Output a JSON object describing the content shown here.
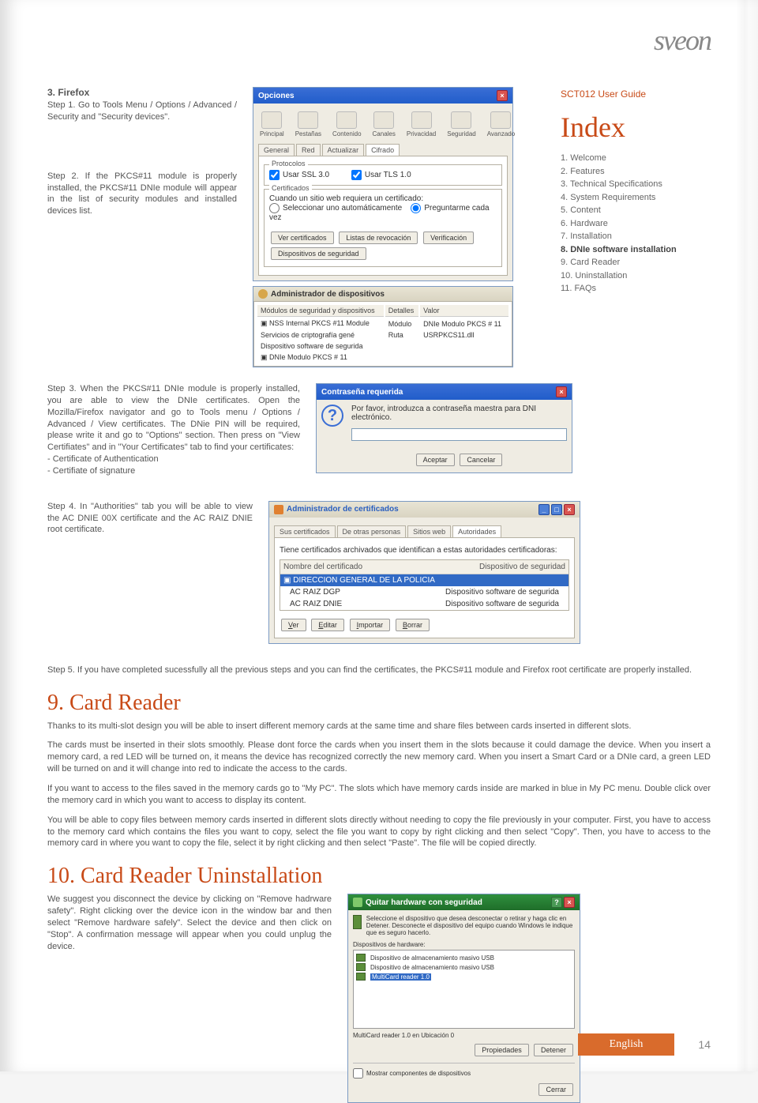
{
  "brand": "sveon",
  "sidebar": {
    "guide_title": "SCT012 User Guide",
    "index_title": "Index",
    "items": [
      "1. Welcome",
      "2. Features",
      "3. Technical Specifications",
      "4. System Requirements",
      "5. Content",
      "6. Hardware",
      "7. Installation",
      "8. DNIe software installation",
      "9. Card Reader",
      "10. Uninstallation",
      "11. FAQs"
    ],
    "bold_index": 7
  },
  "firefox": {
    "heading": "3. Firefox",
    "step1": "Step 1. Go to Tools Menu / Options / Advanced / Security and \"Security devices\".",
    "step2": "Step 2. If the PKCS#11 module is properly installed, the PKCS#11 DNIe module will appear in the list of security modules and installed devices list.",
    "step3": "Step 3. When the PKCS#11 DNIe module is properly installed, you are able to view the DNIe certificates. Open the Mozilla/Firefox navigator and go to Tools menu / Options / Advanced / View certificates. The DNie PIN will be required, please write it and go to \"Options\" section. Then press on \"View Certifiates\" and in \"Your Certificates\" tab to find your certificates:\n- Certificate of Authentication\n- Certifiate of signature",
    "step4": "Step 4. In \"Authorities\" tab you will be able to view the AC DNIE 00X certificate and the AC RAIZ DNIE root certificate.",
    "step5": "Step 5. If you have completed sucessfully all the previous steps and you can find the certificates, the PKCS#11 module and Firefox root certificate are properly installed."
  },
  "opciones": {
    "title": "Opciones",
    "toolbar": [
      "Principal",
      "Pestañas",
      "Contenido",
      "Canales",
      "Privacidad",
      "Seguridad",
      "Avanzado"
    ],
    "tabs": [
      "General",
      "Red",
      "Actualizar",
      "Cifrado"
    ],
    "tab_selected": "Cifrado",
    "group1": "Protocolos",
    "ssl": "Usar SSL 3.0",
    "tls": "Usar TLS 1.0",
    "group2": "Certificados",
    "cert_prompt": "Cuando un sitio web requiera un certificado:",
    "radio1": "Seleccionar uno automáticamente",
    "radio2": "Preguntarme cada vez",
    "btns": [
      "Ver certificados",
      "Listas de revocación",
      "Verificación",
      "Dispositivos de seguridad"
    ]
  },
  "devmgr": {
    "title": "Administrador de dispositivos",
    "cols": [
      "Módulos de seguridad y dispositivos",
      "Detalles",
      "Valor"
    ],
    "rows": [
      [
        "NSS Internal PKCS #11 Module",
        "Módulo",
        "DNIe Modulo PKCS # 11"
      ],
      [
        "Servicios de criptografía gené",
        "Ruta",
        "USRPKCS11.dll"
      ],
      [
        "Dispositivo software de segurida",
        "",
        ""
      ],
      [
        "DNIe Modulo PKCS # 11",
        "",
        ""
      ]
    ]
  },
  "pwd": {
    "title": "Contraseña requerida",
    "msg": "Por favor, introduzca a contraseña maestra para DNI electrónico.",
    "ok": "Aceptar",
    "cancel": "Cancelar"
  },
  "certmgr": {
    "title": "Administrador de certificados",
    "tabs": [
      "Sus certificados",
      "De otras personas",
      "Sitios web",
      "Autoridades"
    ],
    "tab_selected": "Autoridades",
    "desc": "Tiene certificados archivados que identifican a estas autoridades certificadoras:",
    "col1": "Nombre del certificado",
    "col2": "Dispositivo de seguridad",
    "root": "DIRECCION GENERAL DE LA POLICIA",
    "r1n": "AC RAIZ DGP",
    "r1v": "Dispositivo software de segurida",
    "r2n": "AC RAIZ DNIE",
    "r2v": "Dispositivo software de segurida",
    "btns": [
      "Ver",
      "Editar",
      "Importar",
      "Borrar"
    ]
  },
  "section9": {
    "title": "9. Card Reader",
    "p1": "Thanks to its multi-slot design you will be able to insert different memory cards at the same time and share files between cards inserted in different slots.",
    "p2": "The cards must be inserted in their slots smoothly. Please dont force the cards when you insert them in the slots because it could damage the device. When you insert a memory card, a red LED will be turned on, it means the device has recognized correctly the new memory card. When you insert a Smart Card or a DNIe card, a green LED will be turned on and it will change into red to indicate the access to the cards.",
    "p3": "If you want to access to the files saved in the memory cards go to \"My PC\". The slots which have memory cards inside are marked in blue in My PC menu. Double click over the memory card in which you want to access to display its content.",
    "p4": "You will be able to copy files between memory cards inserted in different slots directly without needing to copy the file previously in your computer. First, you have to access to the memory card which contains the files you want to copy, select the file you want to copy by right clicking and then select \"Copy\". Then, you have to access to the memory card in where you want to copy the file, select it by right clicking and then select \"Paste\". The file will be copied directly."
  },
  "section10": {
    "title": "10. Card Reader Uninstallation",
    "p1": "We suggest you disconnect the device by clicking on \"Remove hadrware safety\". Right clicking over the device icon in the window bar and then select \"Remove hardware safely\". Select the device and then click on \"Stop\". A confirmation message will appear when you could unplug the device."
  },
  "safehw": {
    "title": "Quitar hardware con seguridad",
    "desc": "Seleccione el dispositivo que desea desconectar o retirar y haga clic en Detener. Desconecte el dispositivo del equipo cuando Windows le indique que es seguro hacerlo.",
    "group": "Dispositivos de hardware:",
    "d1": "Dispositivo de almacenamiento masivo USB",
    "d2": "Dispositivo de almacenamiento masivo USB",
    "d3": "MultiCard reader 1.0",
    "loc": "MultiCard reader 1.0 en Ubicación 0",
    "btn_props": "Propiedades",
    "btn_stop": "Detener",
    "chk": "Mostrar componentes de dispositivos",
    "close": "Cerrar"
  },
  "footer": {
    "lang": "English",
    "page": "14"
  }
}
